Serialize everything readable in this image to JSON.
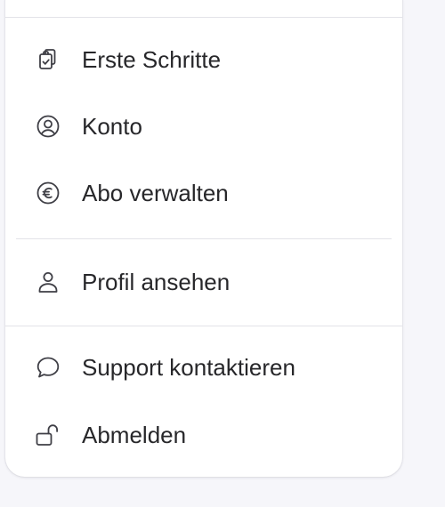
{
  "menu": {
    "items": [
      {
        "label": "Erste Schritte",
        "icon": "clipboard-check-icon"
      },
      {
        "label": "Konto",
        "icon": "user-circle-icon"
      },
      {
        "label": "Abo verwalten",
        "icon": "euro-circle-icon"
      },
      {
        "label": "Profil ansehen",
        "icon": "user-icon"
      },
      {
        "label": "Support kontaktieren",
        "icon": "chat-bubble-icon"
      },
      {
        "label": "Abmelden",
        "icon": "unlock-icon"
      }
    ]
  },
  "colors": {
    "text": "#27272a",
    "icon": "#3f3f46",
    "separator": "#e3e3e8",
    "panel": "#ffffff",
    "background": "#f6f6fa"
  }
}
